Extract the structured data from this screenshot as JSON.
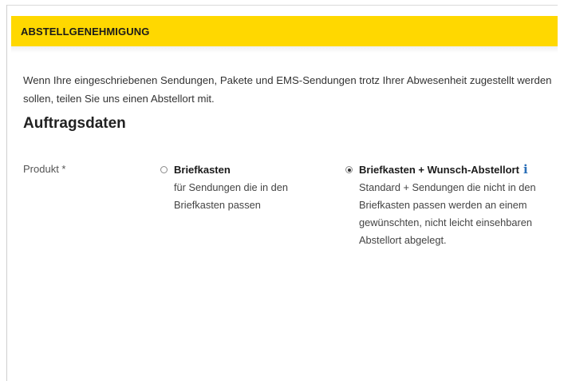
{
  "banner": {
    "title": "ABSTELLGENEHMIGUNG"
  },
  "intro_text": "Wenn Ihre eingeschriebenen Sendungen, Pakete und EMS-Sendungen trotz Ihrer Abwesenheit zugestellt werden sollen, teilen Sie uns einen Abstellort mit.",
  "section": {
    "title": "Auftragsdaten"
  },
  "product": {
    "label": "Produkt *",
    "options": [
      {
        "title": "Briefkasten",
        "description": "für Sendungen die in den Briefkasten passen",
        "selected": false
      },
      {
        "title": "Briefkasten + Wunsch-Abstellort",
        "description": "Standard + Sendungen die nicht in den Briefkasten passen werden an einem gewünschten, nicht leicht einsehbaren Abstellort abgelegt.",
        "selected": true,
        "info_icon": "info-icon"
      }
    ]
  },
  "colors": {
    "banner": "#ffd800",
    "info_icon": "#2a6fb8"
  }
}
